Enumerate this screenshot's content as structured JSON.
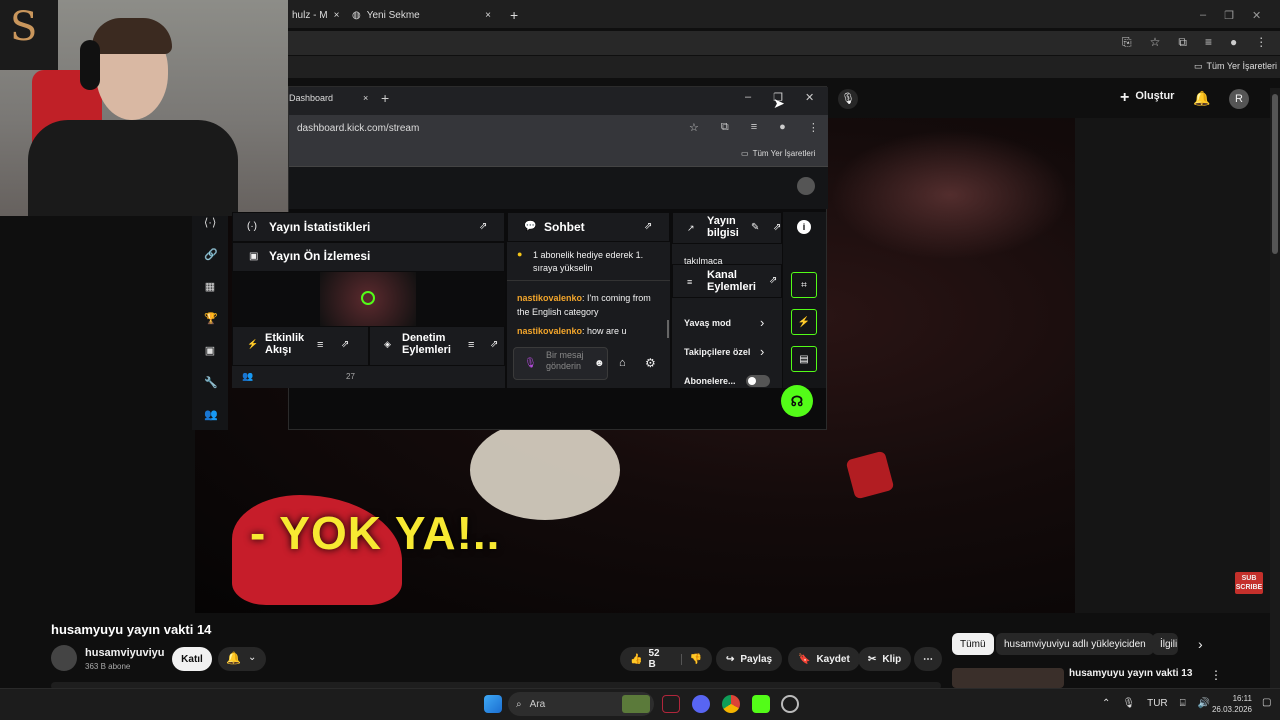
{
  "back_browser": {
    "tab1_label": "hulz - M",
    "tab2_label": "Yeni Sekme",
    "new_tab": "+",
    "bookmarks_label": "Tüm Yer İşaretleri"
  },
  "youtube": {
    "create_label": "Oluştur",
    "profile_initial": "R",
    "video_caption": "- YOK YA!..",
    "subscribe_badge": "SUB SCRIBE",
    "video_title": "husamyuyu yayın vakti 14",
    "channel_name": "husamviyuviyu",
    "subscribers": "363 B abone",
    "join_label": "Katıl",
    "like_count": "52 B",
    "share_label": "Paylaş",
    "save_label": "Kaydet",
    "clip_label": "Klip",
    "chips": [
      "Tümü",
      "husamviyuviyu adlı yükleyiciden",
      "İlgili"
    ],
    "rec_title": "husamyuyu yayın vakti 13"
  },
  "popup": {
    "tab_label": "Dashboard",
    "url": "dashboard.kick.com/stream",
    "bookmarks_label": "Tüm Yer İşaretleri",
    "stats_title": "Yayın İstatistikleri",
    "preview_title": "Yayın Ön İzlemesi",
    "activity_title": "Etkinlik Akışı",
    "activity_count": "27",
    "moderation_title": "Denetim Eylemleri",
    "chat_title": "Sohbet",
    "chat_notice": "1 abonelik hediye ederek 1. sıraya yükselin",
    "chat_messages": [
      {
        "user": "nastikovalenko",
        "text": ": I'm coming from the English category"
      },
      {
        "user": "nastikovalenko",
        "text": ": how are u"
      }
    ],
    "chat_placeholder": "Bir mesaj gönderin",
    "stream_info_title": "Yayın bilgisi",
    "stream_info_sub": "takılmaca",
    "channel_actions_title": "Kanal Eylemleri",
    "actions": [
      "Yavaş mod",
      "Takipçilere özel",
      "Abonelere..."
    ]
  },
  "taskbar": {
    "search_label": "Ara",
    "lang": "TUR",
    "time": "16:11",
    "date": "26.03.2026"
  },
  "colors": {
    "kick_green": "#53fc18",
    "yt_red": "#c4302b"
  }
}
